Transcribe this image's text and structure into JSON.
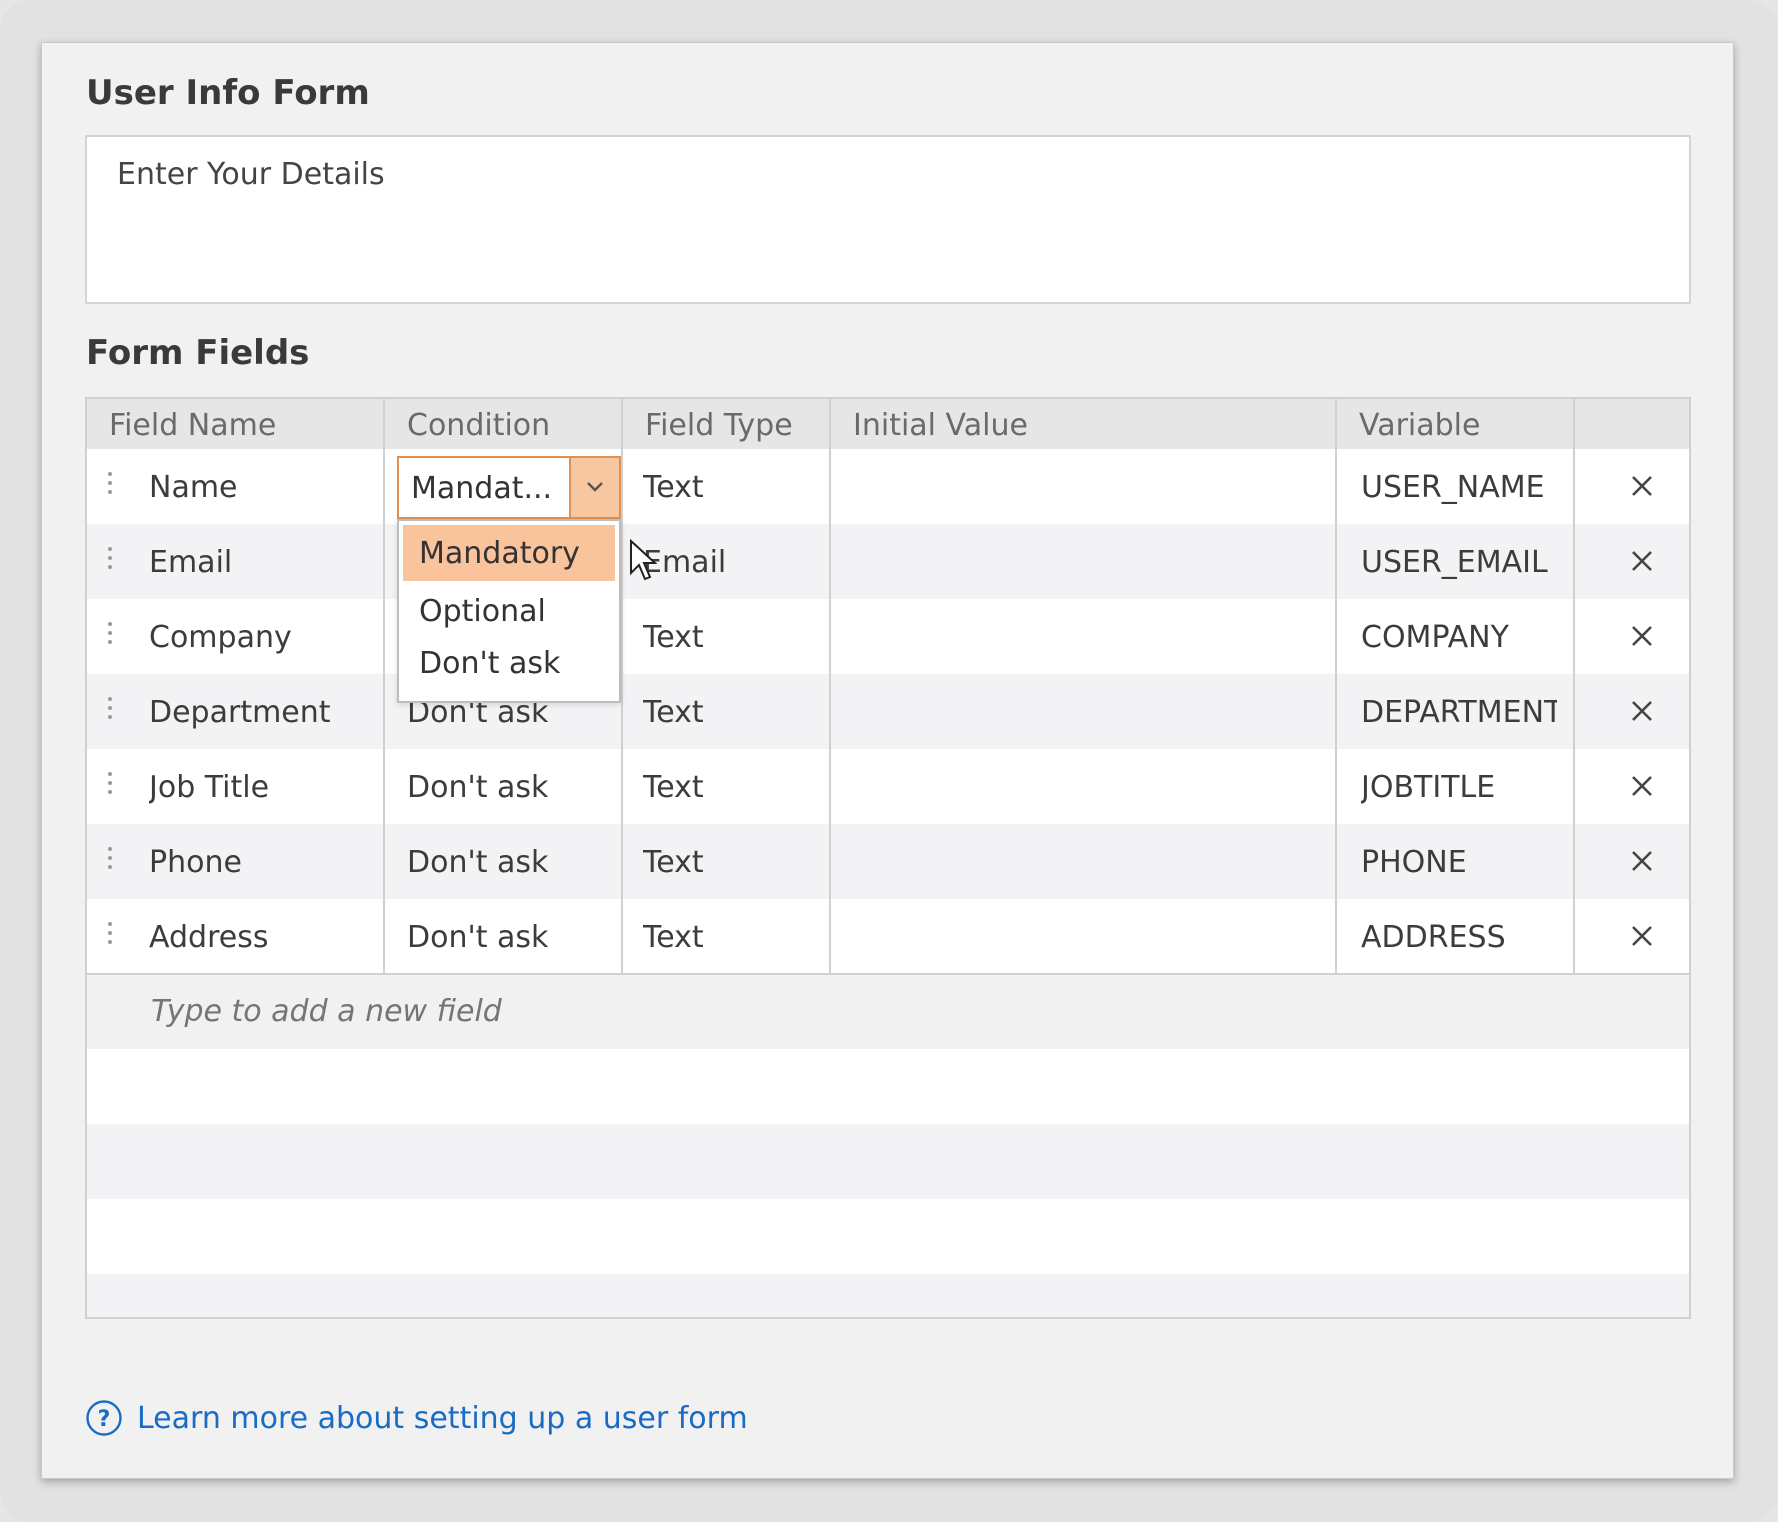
{
  "form": {
    "title": "User Info Form",
    "description": "Enter Your Details"
  },
  "fields_section": {
    "title": "Form Fields",
    "columns": [
      "Field Name",
      "Condition",
      "Field Type",
      "Initial Value",
      "Variable",
      ""
    ],
    "rows": [
      {
        "name": "Name",
        "condition": "Mandat...",
        "type": "Text",
        "initial": "",
        "variable": "USER_NAME"
      },
      {
        "name": "Email",
        "condition": "",
        "type": "Email",
        "initial": "",
        "variable": "USER_EMAIL"
      },
      {
        "name": "Company",
        "condition": "",
        "type": "Text",
        "initial": "",
        "variable": "COMPANY"
      },
      {
        "name": "Department",
        "condition": "Don't ask",
        "type": "Text",
        "initial": "",
        "variable": "DEPARTMENT"
      },
      {
        "name": "Job Title",
        "condition": "Don't ask",
        "type": "Text",
        "initial": "",
        "variable": "JOBTITLE"
      },
      {
        "name": "Phone",
        "condition": "Don't ask",
        "type": "Text",
        "initial": "",
        "variable": "PHONE"
      },
      {
        "name": "Address",
        "condition": "Don't ask",
        "type": "Text",
        "initial": "",
        "variable": "ADDRESS"
      }
    ],
    "add_placeholder": "Type to add a new field",
    "condition_dropdown": {
      "value": "Mandat...",
      "options": [
        "Mandatory",
        "Optional",
        "Don't ask"
      ],
      "highlighted": "Mandatory"
    }
  },
  "help": {
    "icon": "question-circle-icon",
    "link_text": "Learn more about setting up a user form"
  },
  "colors": {
    "accent": "#e2904f",
    "accent_light": "#f9c39c",
    "link": "#1a6bc4"
  }
}
